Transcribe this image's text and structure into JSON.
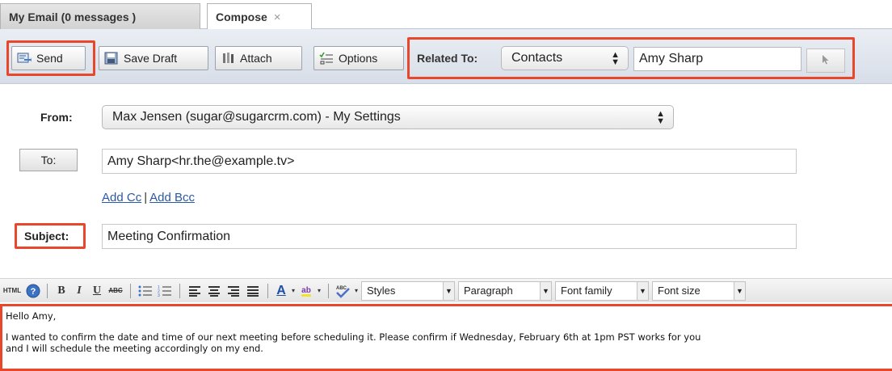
{
  "tabs": [
    {
      "label": "My Email (0 messages )"
    },
    {
      "label": "Compose",
      "close": "×"
    }
  ],
  "toolbar": {
    "send_label": "Send",
    "save_draft_label": "Save Draft",
    "attach_label": "Attach",
    "options_label": "Options",
    "related_to_label": "Related To:",
    "related_module_value": "Contacts",
    "related_record_value": "Amy Sharp"
  },
  "form": {
    "from_label": "From:",
    "from_value": "Max Jensen (sugar@sugarcrm.com) - My Settings",
    "to_label": "To:",
    "to_value": "Amy Sharp<hr.the@example.tv>",
    "add_cc": "Add Cc",
    "add_bcc": "Add Bcc",
    "link_separator": "|",
    "subject_label": "Subject:",
    "subject_value": "Meeting Confirmation"
  },
  "editor_toolbar": {
    "html_label": "HTML",
    "bold": "B",
    "italic": "I",
    "underline": "U",
    "strike": "ABC",
    "font_color": "A",
    "highlight": "ab",
    "spell": "ABC",
    "styles": "Styles",
    "paragraph": "Paragraph",
    "font_family": "Font family",
    "font_size": "Font size"
  },
  "editor_body": {
    "line1": "Hello Amy,",
    "line2": "I wanted to confirm the date and time of our next meeting before scheduling it. Please confirm if Wednesday, February 6th at 1pm PST works for you",
    "line3": "and I will schedule the meeting accordingly on my end."
  },
  "colors": {
    "highlight_border": "#e8472b",
    "link": "#2a5aa4"
  }
}
